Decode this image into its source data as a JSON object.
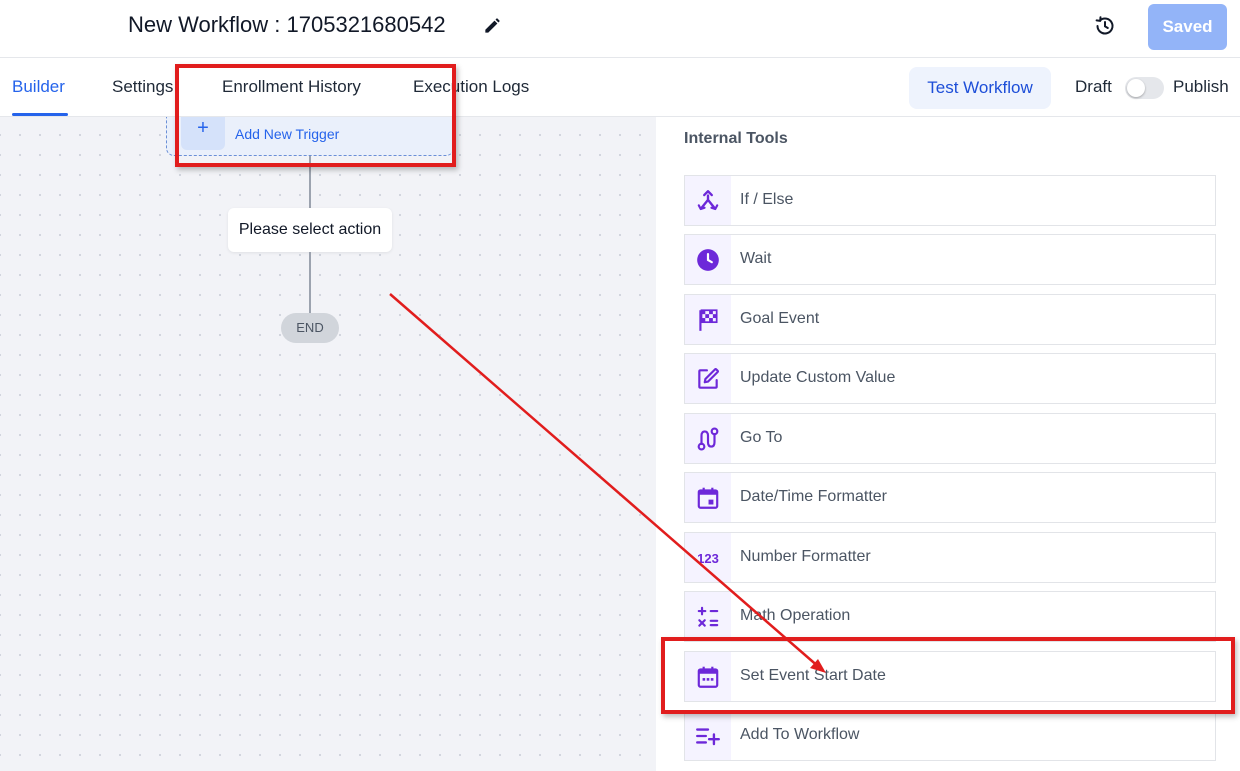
{
  "header": {
    "title": "New Workflow : 1705321680542",
    "saved_label": "Saved"
  },
  "tabs": [
    {
      "label": "Builder",
      "active": true
    },
    {
      "label": "Settings",
      "active": false
    },
    {
      "label": "Enrollment History",
      "active": false
    },
    {
      "label": "Execution Logs",
      "active": false
    }
  ],
  "toolbar": {
    "test_label": "Test Workflow",
    "draft_label": "Draft",
    "publish_label": "Publish",
    "publish_on": false
  },
  "canvas": {
    "trigger_label": "Add New Trigger",
    "action_placeholder": "Please select action",
    "end_label": "END"
  },
  "panel": {
    "section_title": "Internal Tools",
    "items": [
      {
        "label": "If / Else",
        "icon": "split-icon"
      },
      {
        "label": "Wait",
        "icon": "clock-icon"
      },
      {
        "label": "Goal Event",
        "icon": "checkered-flag-icon"
      },
      {
        "label": "Update Custom Value",
        "icon": "edit-icon"
      },
      {
        "label": "Go To",
        "icon": "route-icon"
      },
      {
        "label": "Date/Time Formatter",
        "icon": "calendar-icon"
      },
      {
        "label": "Number Formatter",
        "icon": "numbers-icon"
      },
      {
        "label": "Math Operation",
        "icon": "calculator-icon"
      },
      {
        "label": "Set Event Start Date",
        "icon": "calendar-dots-icon"
      },
      {
        "label": "Add To Workflow",
        "icon": "playlist-add-icon"
      }
    ]
  },
  "colors": {
    "accent": "#2563eb",
    "icon": "#6d28d9",
    "annotation": "#e11d1d"
  }
}
